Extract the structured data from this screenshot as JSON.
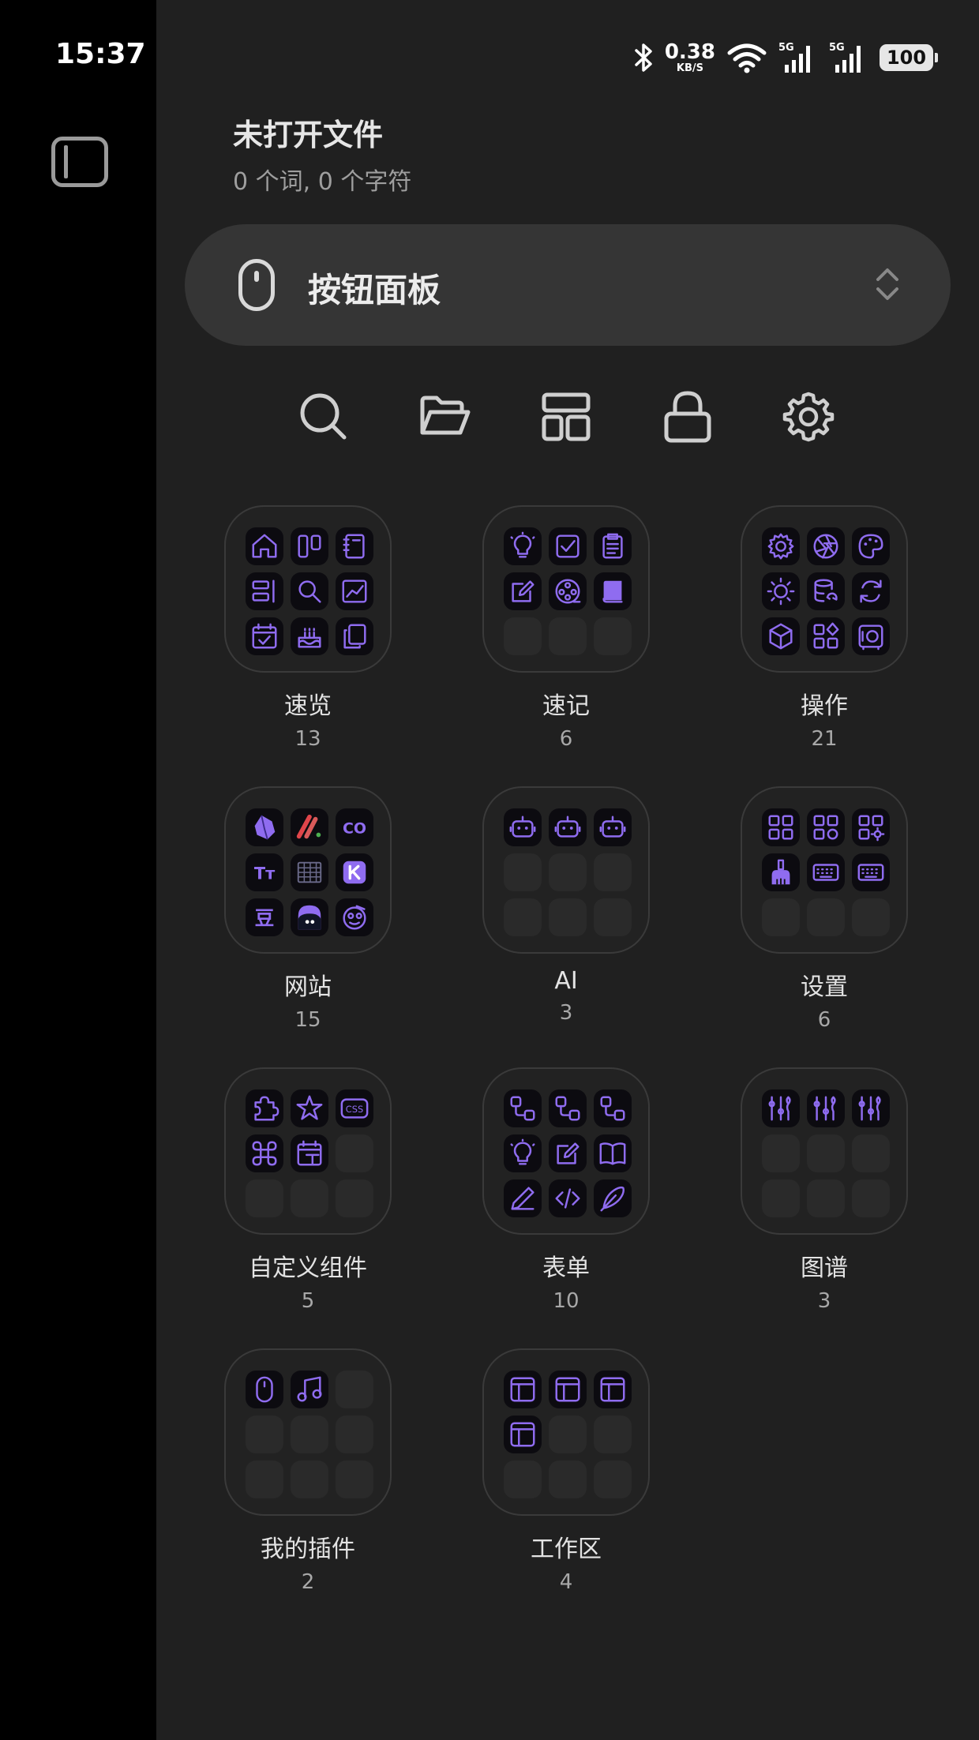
{
  "status_bar": {
    "time": "15:37",
    "net_speed": "0.38",
    "net_unit": "KB/S",
    "network_1": "5G",
    "network_2": "5G",
    "battery": "100"
  },
  "header": {
    "title": "未打开文件",
    "stats": "0 个词, 0 个字符"
  },
  "selector": {
    "label": "按钮面板",
    "icon": "mouse-icon"
  },
  "toolbar": [
    {
      "name": "search",
      "icon": "search-icon"
    },
    {
      "name": "open-folder",
      "icon": "folder-open-icon"
    },
    {
      "name": "layout",
      "icon": "layout-icon"
    },
    {
      "name": "lock",
      "icon": "lock-icon"
    },
    {
      "name": "settings",
      "icon": "gear-icon"
    }
  ],
  "colors": {
    "accent": "#8f6cf0",
    "panel_bg": "#202020",
    "sidebar_bg": "#000000"
  },
  "groups": [
    {
      "name": "速览",
      "count": "13",
      "icons": [
        "home-icon",
        "kanban-icon",
        "notebook-icon",
        "form-icon",
        "search-icon",
        "chart-icon",
        "calendar-check-icon",
        "cake-icon",
        "copy-icon"
      ]
    },
    {
      "name": "速记",
      "count": "6",
      "icons": [
        "bulb-icon",
        "checkbox-icon",
        "clipboard-icon",
        "edit-icon",
        "film-reel-icon",
        "book-icon"
      ]
    },
    {
      "name": "操作",
      "count": "21",
      "icons": [
        "gear-icon",
        "aperture-icon",
        "palette-icon",
        "sun-moon-icon",
        "database-refresh-icon",
        "refresh-icon",
        "cube-icon",
        "shapes-icon",
        "safe-icon"
      ]
    },
    {
      "name": "网站",
      "count": "15",
      "icons": [
        "obsidian-icon",
        "slash-app-icon",
        "co-icon",
        "text-size-icon",
        "table-icon",
        "k-app-icon",
        "dou-icon",
        "monster-icon",
        "face-icon"
      ]
    },
    {
      "name": "AI",
      "count": "3",
      "icons": [
        "robot-icon",
        "robot-icon",
        "robot-icon"
      ]
    },
    {
      "name": "设置",
      "count": "6",
      "icons": [
        "grid-icon",
        "grid-plus-icon",
        "grid-gear-icon",
        "broom-icon",
        "keyboard-icon",
        "keyboard-icon"
      ]
    },
    {
      "name": "自定义组件",
      "count": "5",
      "icons": [
        "puzzle-icon",
        "star-icon",
        "css-icon",
        "command-icon",
        "calendar-icon"
      ]
    },
    {
      "name": "表单",
      "count": "10",
      "icons": [
        "flow-icon",
        "flow-icon",
        "flow-icon",
        "bulb-icon",
        "edit-icon",
        "book-open-icon",
        "pen-icon",
        "code-icon",
        "feather-icon"
      ]
    },
    {
      "name": "图谱",
      "count": "3",
      "icons": [
        "graph-icon",
        "graph-icon",
        "graph-icon"
      ]
    },
    {
      "name": "我的插件",
      "count": "2",
      "icons": [
        "mouse-icon",
        "music-icon"
      ]
    },
    {
      "name": "工作区",
      "count": "4",
      "icons": [
        "layout-panel-icon",
        "layout-panel-icon",
        "layout-panel-icon",
        "layout-panel-icon"
      ]
    }
  ]
}
